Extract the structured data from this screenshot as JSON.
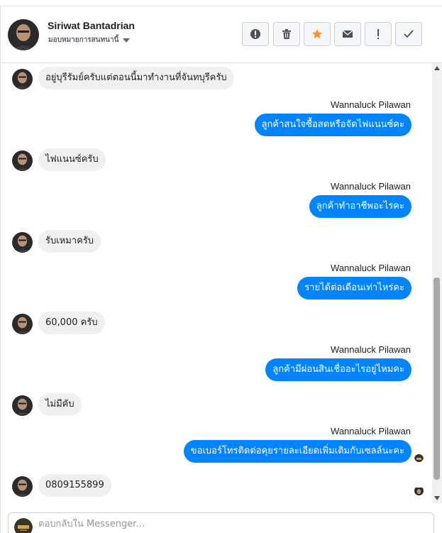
{
  "header": {
    "name": "Siriwat Bantadrian",
    "label": "มอบหมายการสนทนานี้"
  },
  "actions": [
    {
      "name": "report-button",
      "icon": "alert-circle-icon"
    },
    {
      "name": "delete-button",
      "icon": "trash-icon"
    },
    {
      "name": "star-button",
      "icon": "star-icon",
      "color": "#f7923b"
    },
    {
      "name": "mark-unread-button",
      "icon": "envelope-icon"
    },
    {
      "name": "follow-up-button",
      "icon": "exclamation-icon"
    },
    {
      "name": "mark-done-button",
      "icon": "checkmark-icon"
    }
  ],
  "messages": [
    {
      "from": "customer",
      "text": "อยู่บุรีรัมย์ครับแต่ตอนนี้มาทำงานที่จันทบุรีครับ"
    },
    {
      "from": "page",
      "sender": "Wannaluck Pilawan",
      "text": "ลูกค้าสนใจซื้อสดหรือจัดไฟแนนซ์คะ"
    },
    {
      "from": "customer",
      "text": "ไฟแนนซ์ครับ"
    },
    {
      "from": "page",
      "sender": "Wannaluck Pilawan",
      "text": "ลูกค้าทำอาชีพอะไรคะ"
    },
    {
      "from": "customer",
      "text": "รับเหมาครับ"
    },
    {
      "from": "page",
      "sender": "Wannaluck Pilawan",
      "text": "รายได้ต่อเดือนเท่าไหร่คะ"
    },
    {
      "from": "customer",
      "text": "60,000 ครับ"
    },
    {
      "from": "page",
      "sender": "Wannaluck Pilawan",
      "text": "ลูกค้ามีผ่อนสินเชื่ออะไรอยู่ไหมคะ"
    },
    {
      "from": "customer",
      "text": "ไม่มีคับ"
    },
    {
      "from": "page",
      "sender": "Wannaluck Pilawan",
      "text": "ขอเบอร์โทรติดต่อคุยรายละเอียดเพิ่มเติมกับเซลล์นะคะ"
    },
    {
      "from": "customer",
      "text": "0809155899"
    }
  ],
  "composer": {
    "placeholder": "ตอบกลับใน Messenger..."
  },
  "colors": {
    "outgoing_bubble": "#0084ff",
    "incoming_bubble": "#f0f0f0",
    "star": "#f7923b"
  }
}
